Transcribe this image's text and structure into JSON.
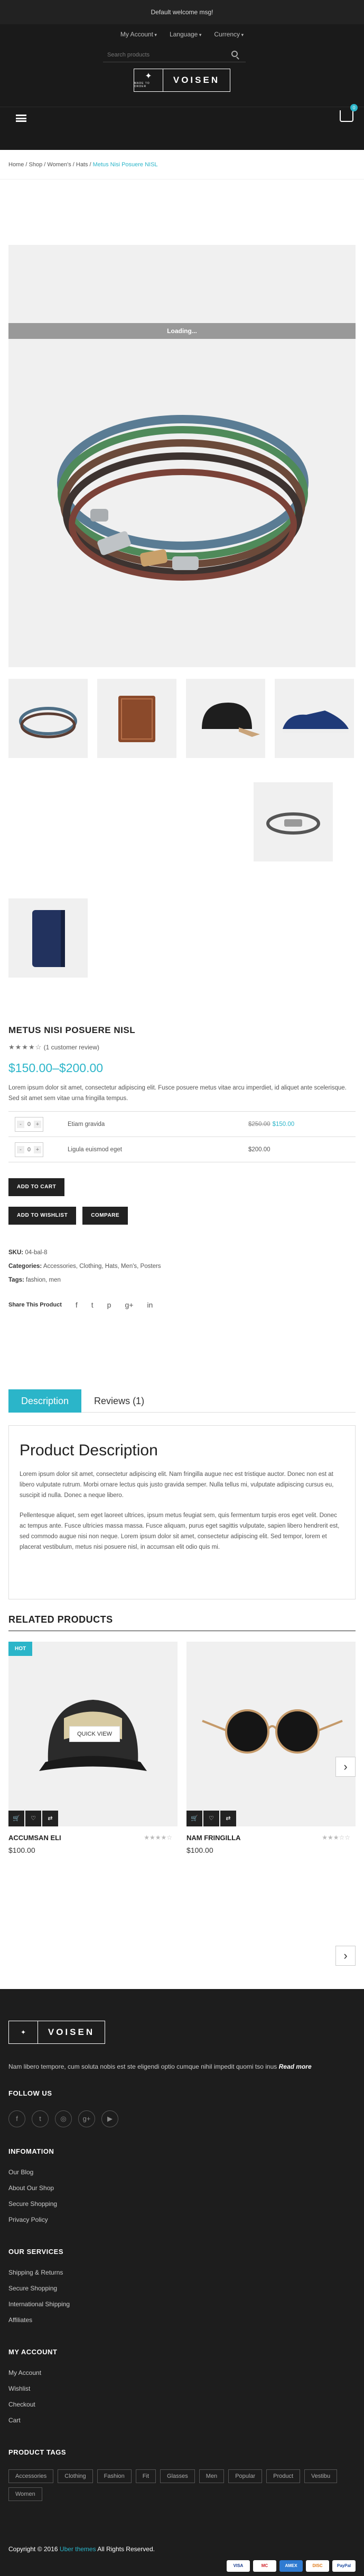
{
  "topbar": {
    "welcome": "Default welcome msg!"
  },
  "topnav": {
    "account": "My Account",
    "language": "Language",
    "currency": "Currency"
  },
  "header": {
    "search_placeholder": "Search products",
    "logo_small": "MADE TO ORDER",
    "logo_word": "VOISEN",
    "cart_count": "0"
  },
  "breadcrumb": {
    "home": "Home",
    "shop": "Shop",
    "women": "Women's",
    "hats": "Hats",
    "current": "Metus Nisi Posuere NISL"
  },
  "gallery": {
    "loading": "Loading..."
  },
  "product": {
    "title": "METUS NISI POSUERE NISL",
    "rating_stars": "★★★★☆",
    "reviews": "(1 customer review)",
    "price": "$150.00–$200.00",
    "description": "Lorem ipsum dolor sit amet, consectetur adipiscing elit. Fusce posuere metus vitae arcu imperdiet, id aliquet ante scelerisque. Sed sit amet sem vitae urna fringilla tempus.",
    "grouped": [
      {
        "qty": "0",
        "name": "Etiam gravida",
        "old_price": "$250.00",
        "price": "$150.00"
      },
      {
        "qty": "0",
        "name": "Ligula euismod eget",
        "old_price": "",
        "price": "$200.00"
      }
    ],
    "add_to_cart": "ADD TO CART",
    "add_to_wishlist": "ADD TO WISHLIST",
    "compare": "COMPARE",
    "sku_label": "SKU:",
    "sku": "04-bal-8",
    "categories_label": "Categories:",
    "categories": "Accessories, Clothing, Hats, Men's, Posters",
    "tags_label": "Tags:",
    "tags": "fashion, men",
    "share_label": "Share This Product",
    "share_icons": [
      "f",
      "t",
      "p",
      "g+",
      "in"
    ]
  },
  "tabs": {
    "description": "Description",
    "reviews": "Reviews (1)"
  },
  "tabpanel": {
    "title": "Product Description",
    "p1": "Lorem ipsum dolor sit amet, consectetur adipiscing elit. Nam fringilla augue nec est tristique auctor. Donec non est at libero vulputate rutrum. Morbi ornare lectus quis justo gravida semper. Nulla tellus mi, vulputate adipiscing cursus eu, suscipit id nulla. Donec a neque libero.",
    "p2": "Pellentesque aliquet, sem eget laoreet ultrices, ipsum metus feugiat sem, quis fermentum turpis eros eget velit. Donec ac tempus ante. Fusce ultricies massa massa. Fusce aliquam, purus eget sagittis vulputate, sapien libero hendrerit est, sed commodo augue nisi non neque. Lorem ipsum dolor sit amet, consectetur adipiscing elit. Sed tempor, lorem et placerat vestibulum, metus nisi posuere nisl, in accumsan elit odio quis mi."
  },
  "related": {
    "title": "RELATED PRODUCTS",
    "items": [
      {
        "badge": "HOT",
        "quick": "QUICK VIEW",
        "name": "ACCUMSAN ELI",
        "price": "$100.00",
        "stars": "★★★★☆"
      },
      {
        "badge": "",
        "quick": "",
        "name": "NAM FRINGILLA",
        "price": "$100.00",
        "stars": "★★★☆☆"
      }
    ]
  },
  "footer": {
    "logo_word": "VOISEN",
    "about": "Nam libero tempore, cum soluta nobis est ste eligendi optio cumque nihil impedit quomi tso inus",
    "read_more": "Read more",
    "follow_us": "FOLLOW US",
    "social": [
      "f",
      "t",
      "◎",
      "g+",
      "▶"
    ],
    "information_title": "INFOMATION",
    "information": [
      "Our Blog",
      "About Our Shop",
      "Secure Shopping",
      "Privacy Policy"
    ],
    "services_title": "OUR SERVICES",
    "services": [
      "Shipping & Returns",
      "Secure Shopping",
      "International Shipping",
      "Affiliates"
    ],
    "account_title": "MY ACCOUNT",
    "account": [
      "My Account",
      "Wishlist",
      "Checkout",
      "Cart"
    ],
    "tags_title": "PRODUCT TAGS",
    "tags": [
      "Accessories",
      "Clothing",
      "Fashion",
      "Fit",
      "Glasses",
      "Men",
      "Popular",
      "Product",
      "Vestibu",
      "Women"
    ],
    "copyright": "Copyright © 2016",
    "brand": "Uber themes",
    "rights": "All Rights Reserved.",
    "payments": [
      "VISA",
      "MC",
      "AMEX",
      "DISC",
      "PayPal"
    ]
  },
  "colors": {
    "accent": "#2bb5c9",
    "dark": "#1d1d1d"
  }
}
